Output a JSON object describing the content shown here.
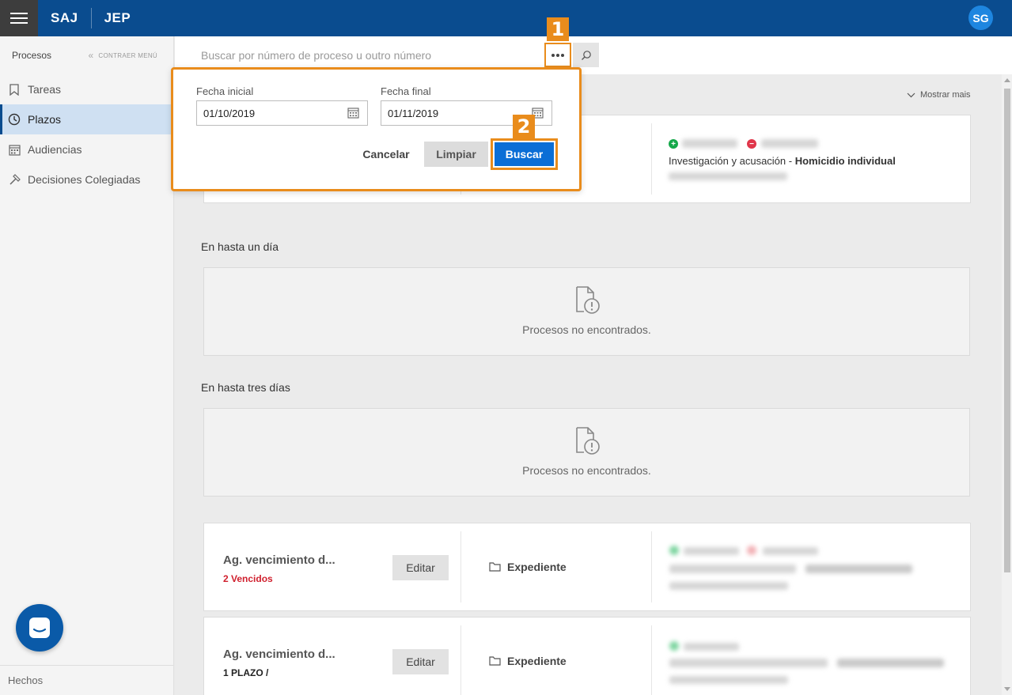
{
  "app": {
    "brand_left": "SAJ",
    "brand_right": "JEP",
    "user_initials": "SG"
  },
  "sidebar": {
    "title": "Procesos",
    "collapse_label": "CONTRAER MENÚ",
    "items": [
      {
        "label": "Tareas",
        "icon": "bookmark-icon",
        "active": false
      },
      {
        "label": "Plazos",
        "icon": "clock-icon",
        "active": true
      },
      {
        "label": "Audiencias",
        "icon": "calendar-icon",
        "active": false
      },
      {
        "label": "Decisiones Colegiadas",
        "icon": "gavel-icon",
        "active": false
      }
    ],
    "footer": "Hechos"
  },
  "search": {
    "placeholder": "Buscar por número de proceso u outro número"
  },
  "annotations": {
    "badge1": "1",
    "badge2": "2"
  },
  "popup": {
    "start_label": "Fecha inicial",
    "start_value": "01/10/2019",
    "end_label": "Fecha final",
    "end_value": "01/11/2019",
    "cancel": "Cancelar",
    "clear": "Limpiar",
    "search": "Buscar"
  },
  "main": {
    "show_more": "Mostrar mais",
    "first_card": {
      "classification": "Investigación y acusación - ",
      "crime": "Homicidio individual"
    },
    "sections": [
      {
        "title": "En hasta un día",
        "empty_text": "Procesos no encontrados."
      },
      {
        "title": "En hasta tres días",
        "empty_text": "Procesos no encontrados."
      }
    ],
    "cards": [
      {
        "title": "Ag. vencimiento d...",
        "subtitle": "2 Vencidos",
        "edit": "Editar",
        "folder": "Expediente"
      },
      {
        "title": "Ag. vencimiento d...",
        "subtitle": "1 PLAZO /",
        "edit": "Editar",
        "folder": "Expediente"
      }
    ]
  },
  "colors": {
    "topbar": "#0a4c8f",
    "accent_orange": "#e98c1c",
    "primary_button": "#0b6ed6",
    "overdue_red": "#d0202e"
  }
}
